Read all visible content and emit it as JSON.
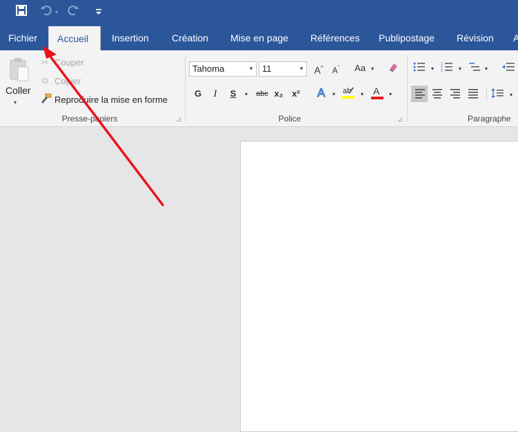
{
  "qat": {
    "save_icon": "save-icon",
    "undo_icon": "undo-icon",
    "redo_icon": "redo-icon",
    "customize_icon": "customize-qat-icon"
  },
  "tabs": [
    {
      "label": "Fichier",
      "active": false
    },
    {
      "label": "Accueil",
      "active": true
    },
    {
      "label": "Insertion",
      "active": false
    },
    {
      "label": "Création",
      "active": false
    },
    {
      "label": "Mise en page",
      "active": false
    },
    {
      "label": "Références",
      "active": false
    },
    {
      "label": "Publipostage",
      "active": false
    },
    {
      "label": "Révision",
      "active": false
    },
    {
      "label": "A",
      "active": false
    }
  ],
  "clipboard": {
    "paste_label": "Coller",
    "cut_label": "Couper",
    "copy_label": "Copier",
    "format_painter_label": "Reproduire la mise en forme",
    "group_label": "Presse-papiers"
  },
  "font": {
    "font_name": "Tahoma",
    "font_size": "11",
    "change_case_label": "Aa",
    "bold_label": "G",
    "italic_label": "I",
    "underline_label": "S",
    "strike_label": "abc",
    "subscript_label": "x₂",
    "superscript_label": "x²",
    "font_color_label": "A",
    "group_label": "Police"
  },
  "paragraph": {
    "group_label": "Paragraphe"
  },
  "colors": {
    "brand": "#2b579a",
    "ribbon": "#f3f3f3",
    "arrow": "#e8141a",
    "highlight": "#ffff00",
    "font_color": "#e81a1a"
  }
}
